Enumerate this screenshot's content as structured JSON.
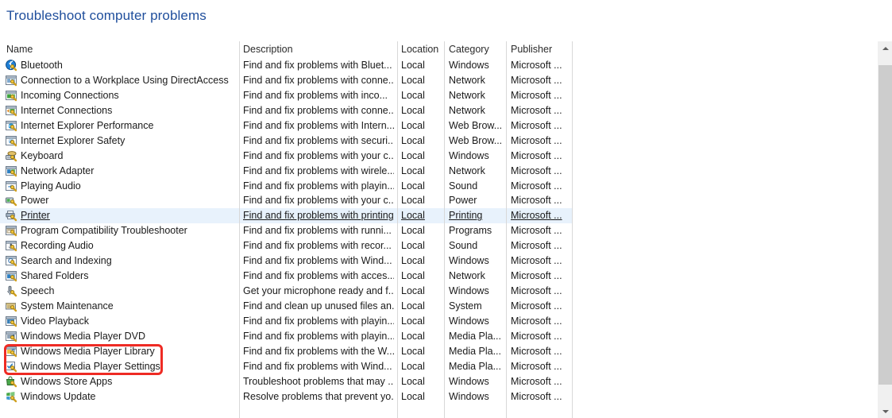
{
  "page": {
    "title": "Troubleshoot computer problems",
    "title_color": "#1f4e9c"
  },
  "table": {
    "columns": [
      {
        "key": "name",
        "label": "Name"
      },
      {
        "key": "description",
        "label": "Description"
      },
      {
        "key": "location",
        "label": "Location"
      },
      {
        "key": "category",
        "label": "Category"
      },
      {
        "key": "publisher",
        "label": "Publisher"
      }
    ],
    "hover_row_index": 10,
    "hover_color": "#e8f2fc",
    "rows": [
      {
        "icon": "bluetooth-icon",
        "name": "Bluetooth",
        "description": "Find and fix problems with Bluet...",
        "location": "Local",
        "category": "Windows",
        "publisher": "Microsoft ..."
      },
      {
        "icon": "directaccess-icon",
        "name": "Connection to a Workplace Using DirectAccess",
        "description": "Find and fix problems with conne...",
        "location": "Local",
        "category": "Network",
        "publisher": "Microsoft ..."
      },
      {
        "icon": "incoming-connections-icon",
        "name": "Incoming Connections",
        "description": "Find and fix problems with inco...",
        "location": "Local",
        "category": "Network",
        "publisher": "Microsoft ..."
      },
      {
        "icon": "internet-connections-icon",
        "name": "Internet Connections",
        "description": "Find and fix problems with conne...",
        "location": "Local",
        "category": "Network",
        "publisher": "Microsoft ..."
      },
      {
        "icon": "ie-performance-icon",
        "name": "Internet Explorer Performance",
        "description": "Find and fix problems with Intern...",
        "location": "Local",
        "category": "Web Brow...",
        "publisher": "Microsoft ..."
      },
      {
        "icon": "ie-safety-icon",
        "name": "Internet Explorer Safety",
        "description": "Find and fix problems with securi...",
        "location": "Local",
        "category": "Web Brow...",
        "publisher": "Microsoft ..."
      },
      {
        "icon": "keyboard-icon",
        "name": "Keyboard",
        "description": "Find and fix problems with your c...",
        "location": "Local",
        "category": "Windows",
        "publisher": "Microsoft ..."
      },
      {
        "icon": "network-adapter-icon",
        "name": "Network Adapter",
        "description": "Find and fix problems with wirele...",
        "location": "Local",
        "category": "Network",
        "publisher": "Microsoft ..."
      },
      {
        "icon": "playing-audio-icon",
        "name": "Playing Audio",
        "description": "Find and fix problems with playin...",
        "location": "Local",
        "category": "Sound",
        "publisher": "Microsoft ..."
      },
      {
        "icon": "power-icon",
        "name": "Power",
        "description": "Find and fix problems with your c...",
        "location": "Local",
        "category": "Power",
        "publisher": "Microsoft ..."
      },
      {
        "icon": "printer-icon",
        "name": "Printer",
        "description": "Find and fix problems with printing",
        "location": "Local",
        "category": "Printing",
        "publisher": "Microsoft ..."
      },
      {
        "icon": "program-compatibility-icon",
        "name": "Program Compatibility Troubleshooter",
        "description": "Find and fix problems with runni...",
        "location": "Local",
        "category": "Programs",
        "publisher": "Microsoft ..."
      },
      {
        "icon": "recording-audio-icon",
        "name": "Recording Audio",
        "description": "Find and fix problems with recor...",
        "location": "Local",
        "category": "Sound",
        "publisher": "Microsoft ..."
      },
      {
        "icon": "search-indexing-icon",
        "name": "Search and Indexing",
        "description": "Find and fix problems with Wind...",
        "location": "Local",
        "category": "Windows",
        "publisher": "Microsoft ..."
      },
      {
        "icon": "shared-folders-icon",
        "name": "Shared Folders",
        "description": "Find and fix problems with acces...",
        "location": "Local",
        "category": "Network",
        "publisher": "Microsoft ..."
      },
      {
        "icon": "speech-icon",
        "name": "Speech",
        "description": "Get your microphone ready and f...",
        "location": "Local",
        "category": "Windows",
        "publisher": "Microsoft ..."
      },
      {
        "icon": "system-maintenance-icon",
        "name": "System Maintenance",
        "description": "Find and clean up unused files an...",
        "location": "Local",
        "category": "System",
        "publisher": "Microsoft ..."
      },
      {
        "icon": "video-playback-icon",
        "name": "Video Playback",
        "description": "Find and fix problems with playin...",
        "location": "Local",
        "category": "Windows",
        "publisher": "Microsoft ..."
      },
      {
        "icon": "wmp-dvd-icon",
        "name": "Windows Media Player DVD",
        "description": "Find and fix problems with playin...",
        "location": "Local",
        "category": "Media Pla...",
        "publisher": "Microsoft ..."
      },
      {
        "icon": "wmp-library-icon",
        "name": "Windows Media Player Library",
        "description": "Find and fix problems with the W...",
        "location": "Local",
        "category": "Media Pla...",
        "publisher": "Microsoft ..."
      },
      {
        "icon": "wmp-settings-icon",
        "name": "Windows Media Player Settings",
        "description": "Find and fix problems with Wind...",
        "location": "Local",
        "category": "Media Pla...",
        "publisher": "Microsoft ..."
      },
      {
        "icon": "windows-store-apps-icon",
        "name": "Windows Store Apps",
        "description": "Troubleshoot problems that may ...",
        "location": "Local",
        "category": "Windows",
        "publisher": "Microsoft ..."
      },
      {
        "icon": "windows-update-icon",
        "name": "Windows Update",
        "description": "Resolve problems that prevent yo...",
        "location": "Local",
        "category": "Windows",
        "publisher": "Microsoft ..."
      }
    ]
  },
  "annotation": {
    "color": "#ee2b24",
    "highlighted_rows": [
      "Windows Media Player Library",
      "Windows Media Player Settings"
    ]
  },
  "scrollbar": {
    "up_arrow": "chevron-up-icon",
    "down_arrow": "chevron-down-icon"
  }
}
